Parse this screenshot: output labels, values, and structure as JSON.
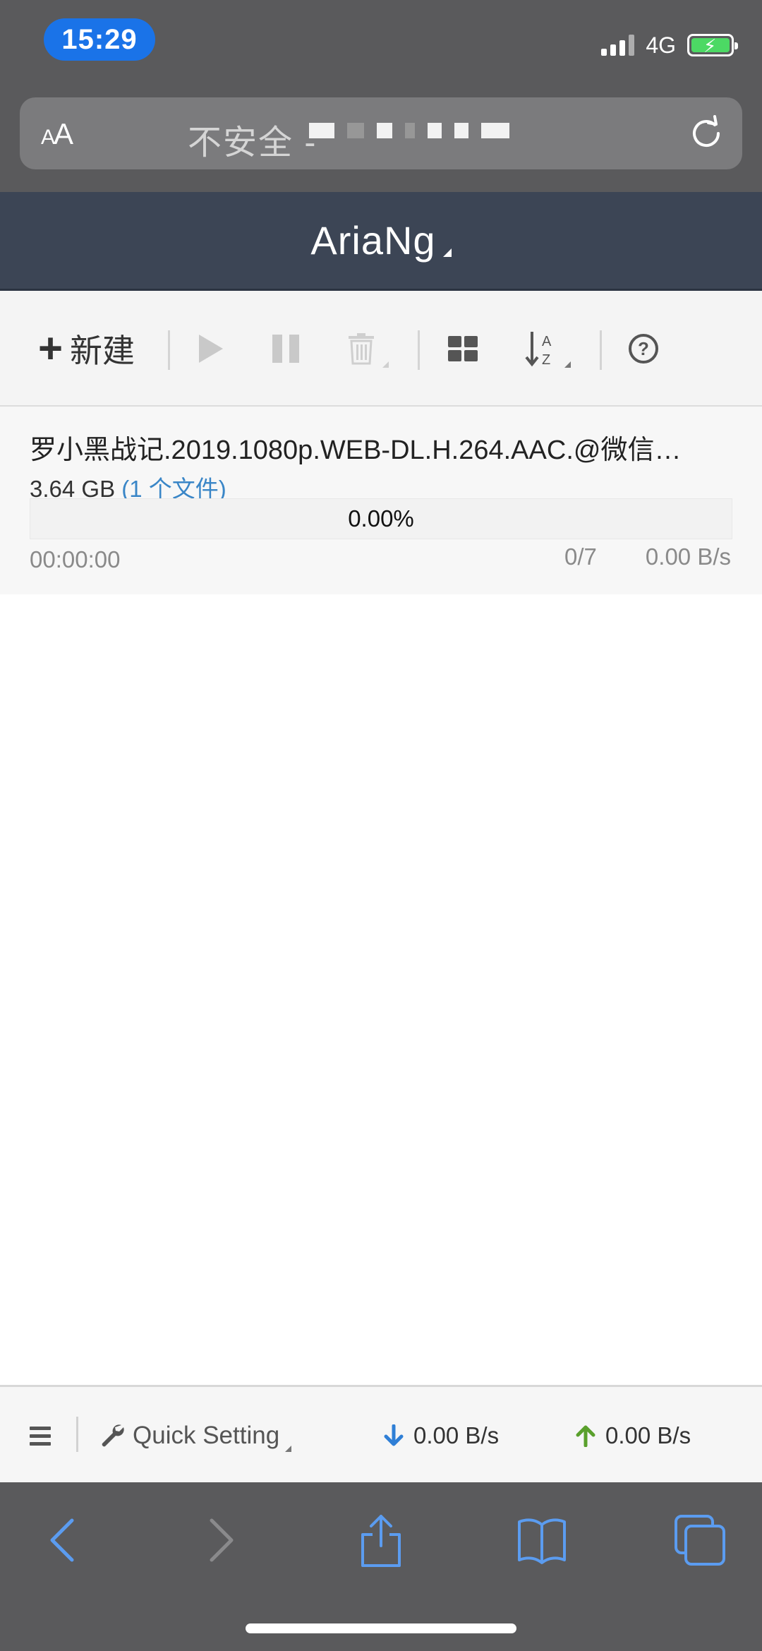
{
  "status_bar": {
    "time": "15:29",
    "network": "4G"
  },
  "url_bar": {
    "aa_small": "A",
    "aa_large": "A",
    "security_text": "不安全 -"
  },
  "header": {
    "title": "AriaNg"
  },
  "toolbar": {
    "new_label": "新建",
    "icons": [
      "plus-icon",
      "play-icon",
      "pause-icon",
      "trash-icon",
      "grid-icon",
      "sort-az-icon",
      "help-icon"
    ]
  },
  "tasks": [
    {
      "name": "罗小黑战记.2019.1080p.WEB-DL.H.264.AAC.@微信…",
      "size": "3.64 GB",
      "files": "(1 个文件)",
      "progress": "0.00%",
      "progress_value": 0,
      "eta": "00:00:00",
      "connections": "0/7",
      "speed": "0.00 B/s"
    }
  ],
  "bottom_bar": {
    "quick_setting": "Quick Setting",
    "download_speed": "0.00 B/s",
    "upload_speed": "0.00 B/s"
  },
  "colors": {
    "header_bg": "#3c4555",
    "link_blue": "#3a86c7",
    "download_arrow": "#2f7fd6",
    "upload_arrow": "#5aa02c",
    "ios_accent": "#5b9cf0"
  }
}
